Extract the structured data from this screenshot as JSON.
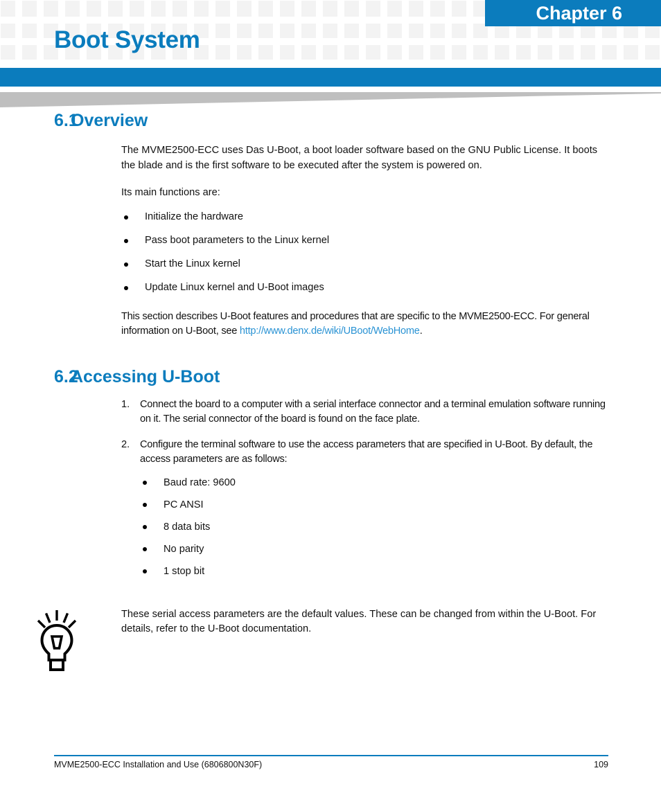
{
  "header": {
    "chapter_label": "Chapter 6",
    "doc_title": "Boot System",
    "accent_color": "#0b7cbd",
    "grid_square_color": "#f3f3f3",
    "wedge_color": "#bfbfbf"
  },
  "sections": [
    {
      "number": "6.1",
      "title": "Overview",
      "paragraphs": [
        "The MVME2500-ECC uses Das U-Boot, a boot loader software based on the GNU Public License. It boots the blade and is the first software to be executed after the system is powered on.",
        "Its main functions are:"
      ],
      "bullets": [
        "Initialize the hardware",
        "Pass boot parameters to the Linux kernel",
        "Start the Linux kernel",
        "Update Linux kernel and U-Boot images"
      ],
      "closing": {
        "lead": "This section describes U-Boot features and procedures that are specific to the MVME2500-ECC. For general information on U-Boot, see ",
        "link_text": "http://www.denx.de/wiki/UBoot/WebHome",
        "link_color": "#2a93d4",
        "tail": "."
      }
    },
    {
      "number": "6.2",
      "title": "Accessing U-Boot",
      "steps": [
        {
          "marker": "1.",
          "text": "Connect the board to a computer with a serial interface connector and a terminal emulation software running on it. The serial connector of the board is found on the face plate."
        },
        {
          "marker": "2.",
          "text": "Configure the terminal software to use the access parameters that are specified in U-Boot. By default, the access parameters are as follows:",
          "sub_bullets": [
            "Baud rate: 9600",
            "PC ANSI",
            "8 data bits",
            "No parity",
            "1 stop bit"
          ]
        }
      ]
    }
  ],
  "tip": {
    "icon": "lightbulb-icon",
    "text": "These serial access parameters are the default values. These can be changed from within the U-Boot. For details, refer to the U-Boot documentation."
  },
  "footer": {
    "document_title": "MVME2500-ECC Installation and Use (6806800N30F)",
    "page_number": "109",
    "rule_color": "#0b7cbd"
  }
}
